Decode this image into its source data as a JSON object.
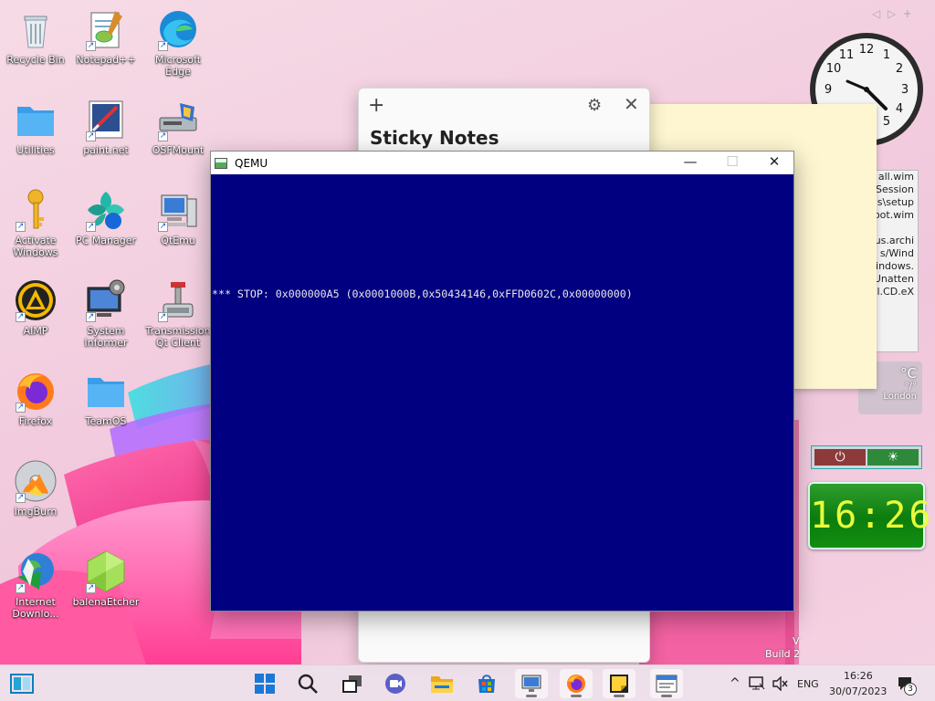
{
  "desktop_icons": [
    {
      "id": "recycle-bin",
      "label": "Recycle Bin",
      "shortcut": false
    },
    {
      "id": "notepadpp",
      "label": "Notepad++",
      "shortcut": true
    },
    {
      "id": "microsoft-edge",
      "label": "Microsoft Edge",
      "shortcut": true
    },
    {
      "id": "utilities",
      "label": "Utilities",
      "shortcut": false
    },
    {
      "id": "paintnet",
      "label": "paint.net",
      "shortcut": true
    },
    {
      "id": "osfmount",
      "label": "OSFMount",
      "shortcut": true
    },
    {
      "id": "activate-windows",
      "label": "Activate Windows",
      "shortcut": true
    },
    {
      "id": "pc-manager",
      "label": "PC Manager",
      "shortcut": true
    },
    {
      "id": "qtemu",
      "label": "QtEmu",
      "shortcut": true
    },
    {
      "id": "aimp",
      "label": "AIMP",
      "shortcut": true
    },
    {
      "id": "system-informer",
      "label": "System Informer",
      "shortcut": true
    },
    {
      "id": "transmission",
      "label": "Transmission Qt Client",
      "shortcut": true
    },
    {
      "id": "firefox",
      "label": "Firefox",
      "shortcut": true
    },
    {
      "id": "teamos",
      "label": "TeamOS",
      "shortcut": false
    },
    {
      "id": "imgburn",
      "label": "ImgBurn",
      "shortcut": true
    },
    {
      "id": "internet-download",
      "label": "Internet Downlo...",
      "shortcut": true
    },
    {
      "id": "balenaetcher",
      "label": "balenaEtcher",
      "shortcut": true
    }
  ],
  "sticky_notes": {
    "title": "Sticky Notes",
    "add_glyph": "+",
    "settings_glyph": "⚙",
    "close_glyph": "✕"
  },
  "background_fragments": [
    "all.wim",
    "Session",
    "s\\setup",
    "oot.wim",
    "",
    "us.archi",
    "s/Wind",
    "indows.",
    "Unatten",
    "l.CD.eX"
  ],
  "weather": {
    "temp_unit": "°C",
    "range": "°/°",
    "city": "London"
  },
  "power_widget": {
    "power_glyph": "⏻",
    "sleep_glyph": "☀"
  },
  "digital_clock": {
    "time": "16:26"
  },
  "analog_clock": {
    "numbers": [
      "12",
      "1",
      "2",
      "3",
      "4",
      "5",
      "9",
      "10",
      "11"
    ]
  },
  "nav_arrows": {
    "prev": "◁",
    "next": "▷",
    "add": "+"
  },
  "build_text": {
    "v": "V",
    "build": "Build 2"
  },
  "qemu": {
    "title": "QEMU",
    "minimize": "—",
    "maximize": "☐",
    "close": "✕",
    "stop_message": "*** STOP: 0x000000A5 (0x0001000B,0x50434146,0xFFD0602C,0x00000000)"
  },
  "taskbar": {
    "items": [
      "show-desktop",
      "start",
      "search",
      "task-view",
      "meet",
      "file-explorer",
      "store",
      "qemu-app",
      "firefox",
      "sticky-notes",
      "window-app"
    ],
    "tray": {
      "chevron": "^",
      "language": "ENG",
      "time": "16:26",
      "date": "30/07/2023",
      "notification_count": "3"
    }
  },
  "colors": {
    "qemu_bg": "#000080",
    "stop_text": "#e8e8e8",
    "digital_clock_text": "#e9ff3a",
    "digital_clock_bg": "#0c7d0c"
  }
}
